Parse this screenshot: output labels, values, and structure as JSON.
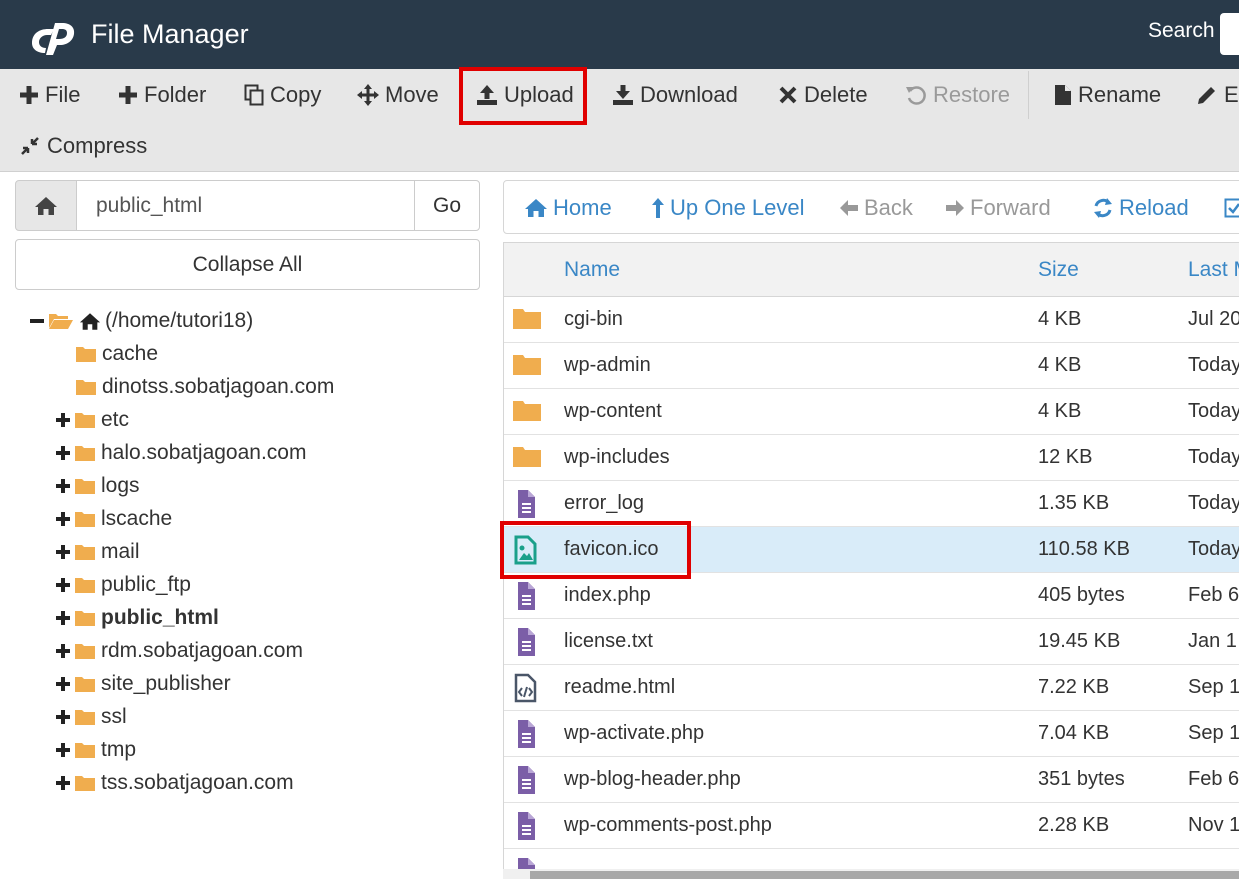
{
  "header": {
    "title": "File Manager",
    "search_label": "Search",
    "bg_color": "#293a4a"
  },
  "toolbar": {
    "file": "File",
    "folder": "Folder",
    "copy": "Copy",
    "move": "Move",
    "upload": "Upload",
    "download": "Download",
    "delete": "Delete",
    "restore": "Restore",
    "rename": "Rename",
    "edit": "Ec",
    "compress": "Compress"
  },
  "left": {
    "path_value": "public_html",
    "go_label": "Go",
    "collapse_label": "Collapse All",
    "tree": [
      {
        "label": "(/home/tutori18)"
      },
      {
        "label": "cache"
      },
      {
        "label": "dinotss.sobatjagoan.com"
      },
      {
        "label": "etc"
      },
      {
        "label": "halo.sobatjagoan.com"
      },
      {
        "label": "logs"
      },
      {
        "label": "lscache"
      },
      {
        "label": "mail"
      },
      {
        "label": "public_ftp"
      },
      {
        "label": "public_html"
      },
      {
        "label": "rdm.sobatjagoan.com"
      },
      {
        "label": "site_publisher"
      },
      {
        "label": "ssl"
      },
      {
        "label": "tmp"
      },
      {
        "label": "tss.sobatjagoan.com"
      }
    ]
  },
  "nav": {
    "home": "Home",
    "up": "Up One Level",
    "back": "Back",
    "forward": "Forward",
    "reload": "Reload"
  },
  "table": {
    "headers": {
      "name": "Name",
      "size": "Size",
      "modified": "Last M"
    },
    "rows": [
      {
        "name": "cgi-bin",
        "size": "4 KB",
        "modified": "Jul 20",
        "icon": "folder-icon"
      },
      {
        "name": "wp-admin",
        "size": "4 KB",
        "modified": "Today",
        "icon": "folder-icon"
      },
      {
        "name": "wp-content",
        "size": "4 KB",
        "modified": "Today",
        "icon": "folder-icon"
      },
      {
        "name": "wp-includes",
        "size": "12 KB",
        "modified": "Today",
        "icon": "folder-icon"
      },
      {
        "name": "error_log",
        "size": "1.35 KB",
        "modified": "Today",
        "icon": "text-file-icon"
      },
      {
        "name": "favicon.ico",
        "size": "110.58 KB",
        "modified": "Today",
        "icon": "image-file-icon"
      },
      {
        "name": "index.php",
        "size": "405 bytes",
        "modified": "Feb 6",
        "icon": "text-file-icon"
      },
      {
        "name": "license.txt",
        "size": "19.45 KB",
        "modified": "Jan 1",
        "icon": "text-file-icon"
      },
      {
        "name": "readme.html",
        "size": "7.22 KB",
        "modified": "Sep 1",
        "icon": "code-file-icon"
      },
      {
        "name": "wp-activate.php",
        "size": "7.04 KB",
        "modified": "Sep 1",
        "icon": "text-file-icon"
      },
      {
        "name": "wp-blog-header.php",
        "size": "351 bytes",
        "modified": "Feb 6",
        "icon": "text-file-icon"
      },
      {
        "name": "wp-comments-post.php",
        "size": "2.28 KB",
        "modified": "Nov 1",
        "icon": "text-file-icon"
      }
    ]
  },
  "colors": {
    "link": "#3a87c6",
    "folder": "#f0ad4e",
    "file_purple": "#7b5ea7",
    "image_teal": "#1aa08a",
    "highlight_red": "#e00000",
    "selected_row": "#d9ecf9"
  }
}
